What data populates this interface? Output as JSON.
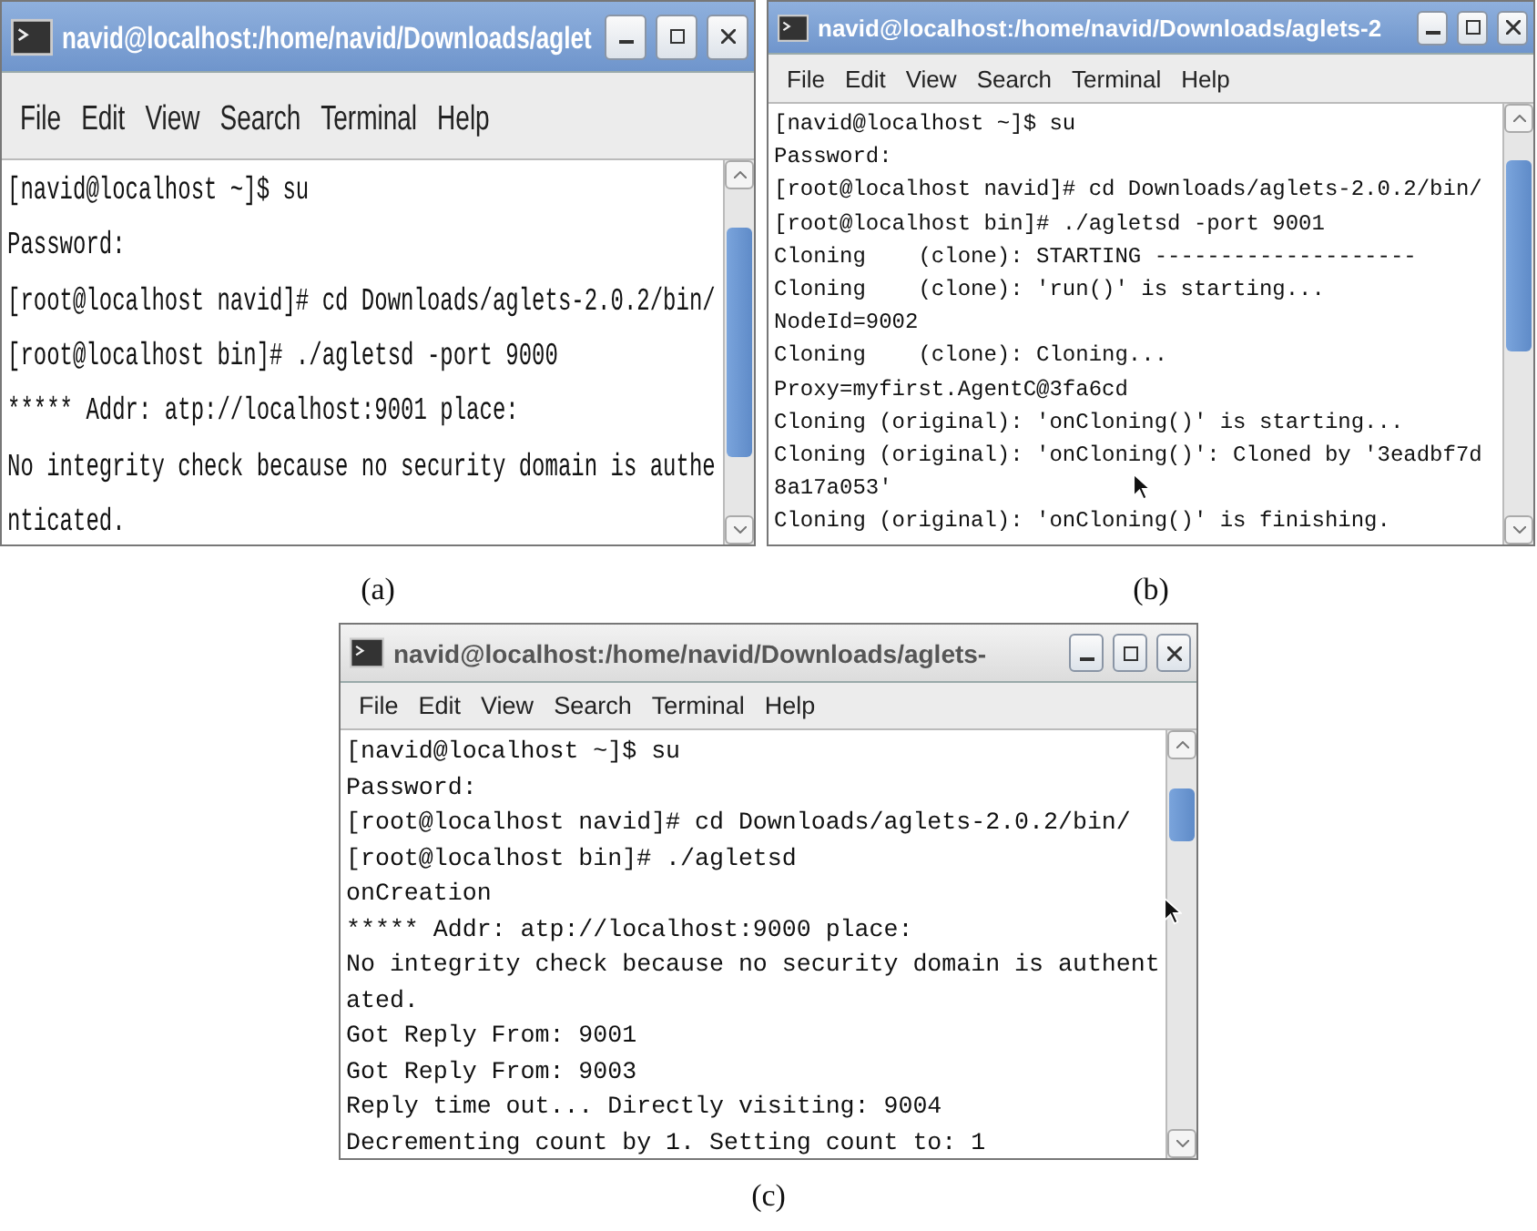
{
  "figures": [
    {
      "caption": "(a)",
      "window": {
        "title": "navid@localhost:/home/navid/Downloads/aglet",
        "active": true
      },
      "menu": [
        "File",
        "Edit",
        "View",
        "Search",
        "Terminal",
        "Help"
      ],
      "lines": [
        "[navid@localhost ~]$ su",
        "Password:",
        "[root@localhost navid]# cd Downloads/aglets-2.0.2/bin/",
        "[root@localhost bin]# ./agletsd -port 9000",
        "***** Addr: atp://localhost:9001 place:",
        "No integrity check because no security domain is authe",
        "nticated."
      ]
    },
    {
      "caption": "(b)",
      "window": {
        "title": "navid@localhost:/home/navid/Downloads/aglets-2",
        "active": true
      },
      "menu": [
        "File",
        "Edit",
        "View",
        "Search",
        "Terminal",
        "Help"
      ],
      "lines": [
        "[navid@localhost ~]$ su",
        "Password:",
        "[root@localhost navid]# cd Downloads/aglets-2.0.2/bin/",
        "[root@localhost bin]# ./agletsd -port 9001",
        "Cloning    (clone): STARTING --------------------",
        "Cloning    (clone): 'run()' is starting...",
        "NodeId=9002",
        "Cloning    (clone): Cloning...",
        "Proxy=myfirst.AgentC@3fa6cd",
        "Cloning (original): 'onCloning()' is starting...",
        "Cloning (original): 'onCloning()': Cloned by '3eadbf7d",
        "8a17a053'",
        "Cloning (original): 'onCloning()' is finishing."
      ]
    },
    {
      "caption": "(c)",
      "window": {
        "title": "navid@localhost:/home/navid/Downloads/aglets-",
        "active": false
      },
      "menu": [
        "File",
        "Edit",
        "View",
        "Search",
        "Terminal",
        "Help"
      ],
      "lines": [
        "[navid@localhost ~]$ su",
        "Password:",
        "[root@localhost navid]# cd Downloads/aglets-2.0.2/bin/",
        "[root@localhost bin]# ./agletsd",
        "onCreation",
        "***** Addr: atp://localhost:9000 place:",
        "No integrity check because no security domain is authent",
        "ated.",
        "Got Reply From: 9001",
        "Got Reply From: 9003",
        "Reply time out... Directly visiting: 9004",
        "Decrementing count by 1. Setting count to: 1"
      ]
    }
  ]
}
